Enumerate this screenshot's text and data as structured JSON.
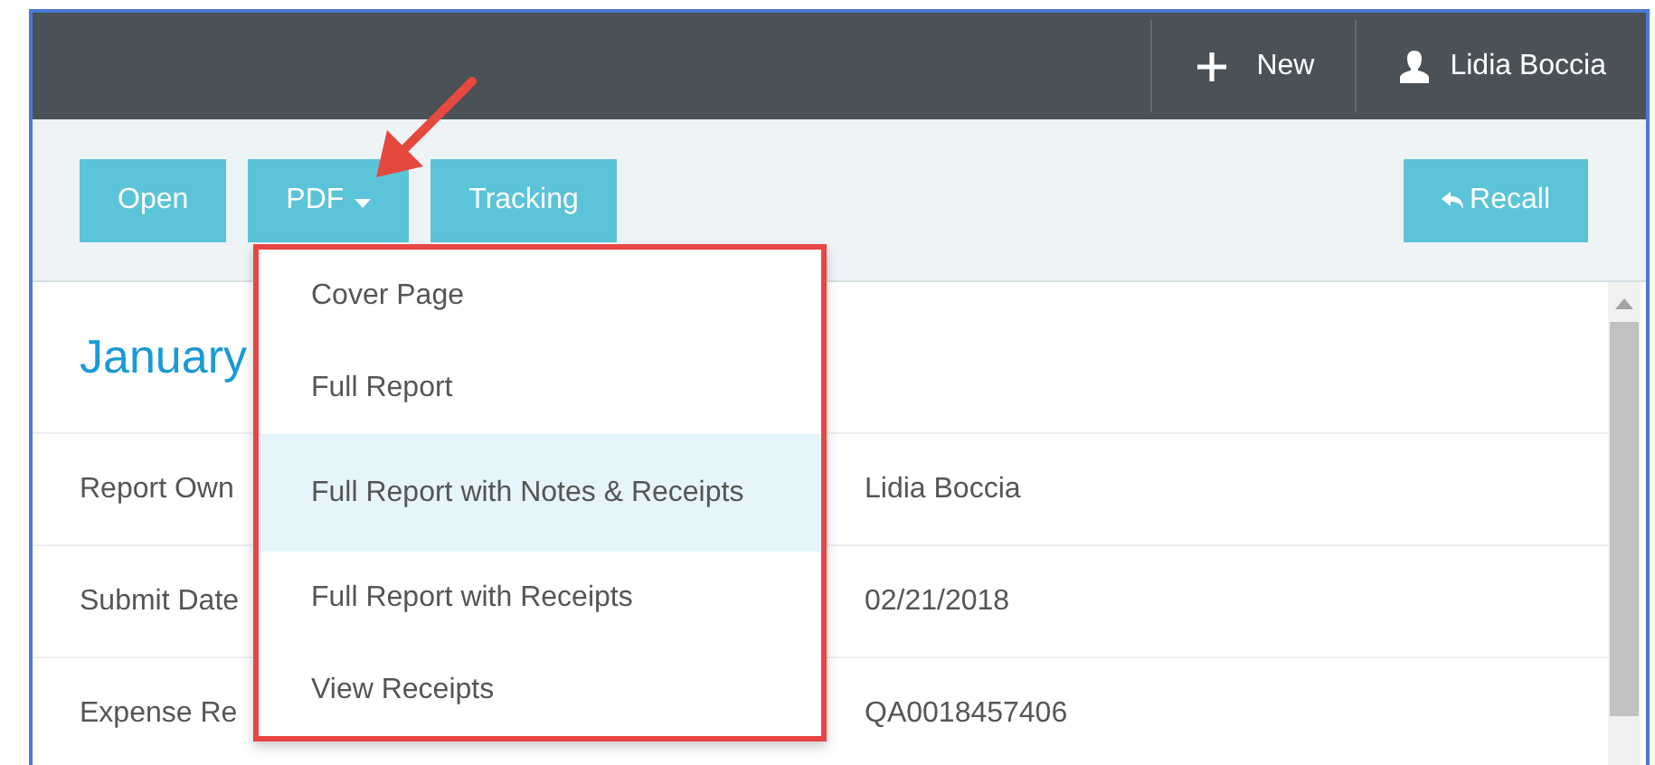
{
  "header": {
    "new_label": "New",
    "user_name": "Lidia Boccia"
  },
  "toolbar": {
    "buttons": [
      {
        "label": "Open",
        "kind": "plain"
      },
      {
        "label": "PDF",
        "kind": "dropdown"
      },
      {
        "label": "Tracking",
        "kind": "plain"
      }
    ],
    "recall_label": "Recall"
  },
  "report": {
    "title": "January",
    "rows": [
      {
        "label": "Report Own",
        "value": "Lidia Boccia"
      },
      {
        "label": "Submit Date",
        "value": "02/21/2018"
      },
      {
        "label": "Expense Re",
        "value": "QA0018457406"
      }
    ]
  },
  "pdf_menu": {
    "items": [
      {
        "label": "Cover Page",
        "selected": false
      },
      {
        "label": "Full Report",
        "selected": false
      },
      {
        "label": "Full Report with Notes & Receipts",
        "selected": true
      },
      {
        "label": "Full Report with Receipts",
        "selected": false
      },
      {
        "label": "View Receipts",
        "selected": false
      }
    ]
  }
}
